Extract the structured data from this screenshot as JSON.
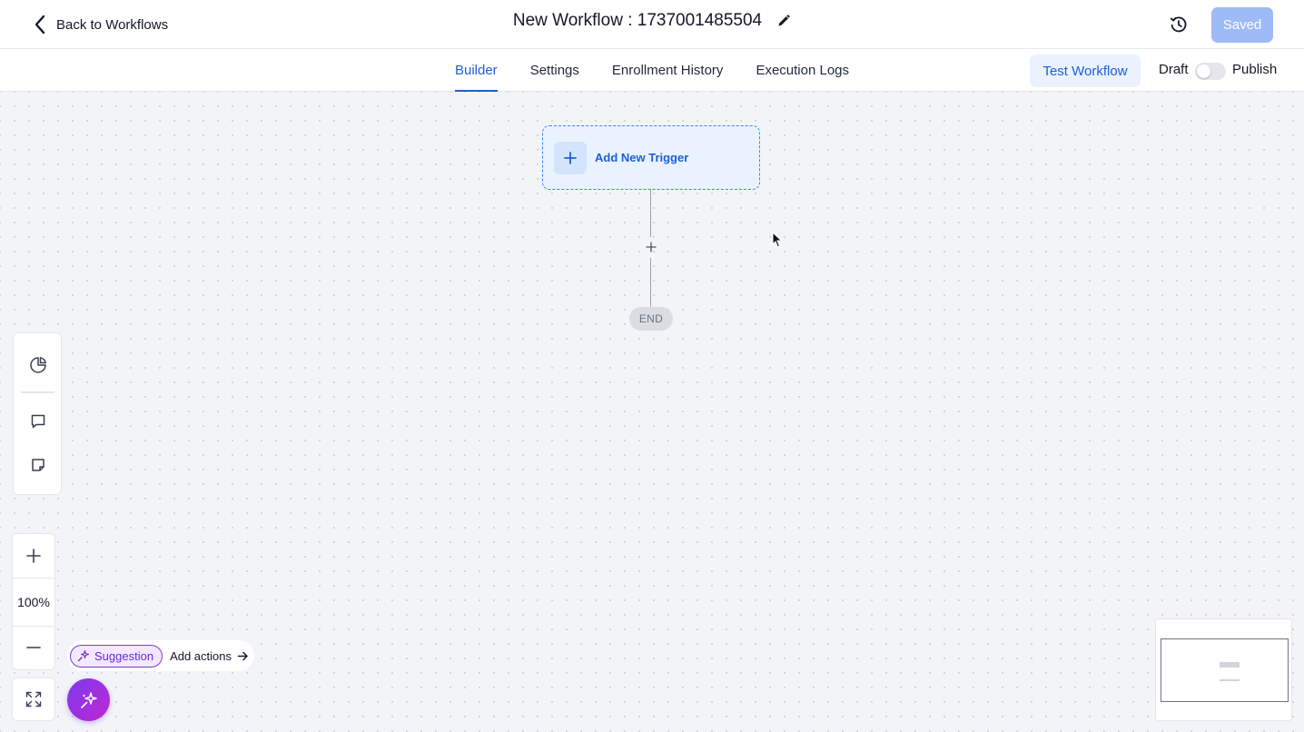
{
  "header": {
    "back_label": "Back to Workflows",
    "title": "New Workflow : 1737001485504",
    "saved_label": "Saved"
  },
  "tabs": [
    {
      "label": "Builder",
      "active": true
    },
    {
      "label": "Settings",
      "active": false
    },
    {
      "label": "Enrollment History",
      "active": false
    },
    {
      "label": "Execution Logs",
      "active": false
    }
  ],
  "actions": {
    "test_workflow_label": "Test Workflow",
    "draft_label": "Draft",
    "publish_label": "Publish",
    "published": false
  },
  "canvas": {
    "trigger_label": "Add New Trigger",
    "end_label": "END"
  },
  "zoom": {
    "level": "100%"
  },
  "suggestion": {
    "chip_label": "Suggestion",
    "action_label": "Add actions"
  },
  "colors": {
    "accent": "#1d5fd6",
    "saved_button": "#9dbbf6",
    "ai_gradient_start": "#7c3aed",
    "ai_gradient_end": "#c026d3"
  },
  "icons": {
    "back": "chevron-left-icon",
    "edit": "pencil-icon",
    "history": "history-clock-icon",
    "pie": "pie-chart-icon",
    "comment": "comment-icon",
    "note": "sticky-note-icon",
    "zoom_in": "plus-icon",
    "zoom_out": "minus-icon",
    "fit": "expand-icon",
    "ai": "sparkle-icon"
  }
}
